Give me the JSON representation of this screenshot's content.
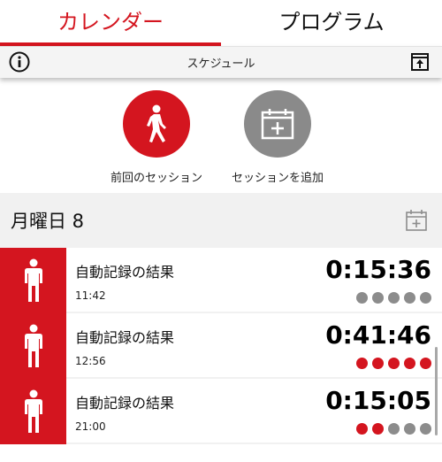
{
  "tabs": [
    {
      "label": "カレンダー",
      "active": true
    },
    {
      "label": "プログラム",
      "active": false
    }
  ],
  "header": {
    "title": "スケジュール"
  },
  "actions": {
    "last_session_label": "前回のセッション",
    "add_session_label": "セッションを追加"
  },
  "day": {
    "title": "月曜日 8"
  },
  "sessions": [
    {
      "title": "自動記録の結果",
      "time": "11:42",
      "duration": "0:15:36",
      "intensity": 0
    },
    {
      "title": "自動記録の結果",
      "time": "12:56",
      "duration": "0:41:46",
      "intensity": 5
    },
    {
      "title": "自動記録の結果",
      "time": "21:00",
      "duration": "0:15:05",
      "intensity": 2
    }
  ],
  "colors": {
    "accent": "#d4151f",
    "gray": "#8c8c8c",
    "header_bg": "#f4f4f4",
    "section_bg": "#f1f1f1"
  },
  "icons": {
    "info": "info-circle-icon",
    "export": "export-icon",
    "walk": "walking-person-icon",
    "calendar_add": "calendar-add-icon",
    "person": "standing-person-icon"
  }
}
